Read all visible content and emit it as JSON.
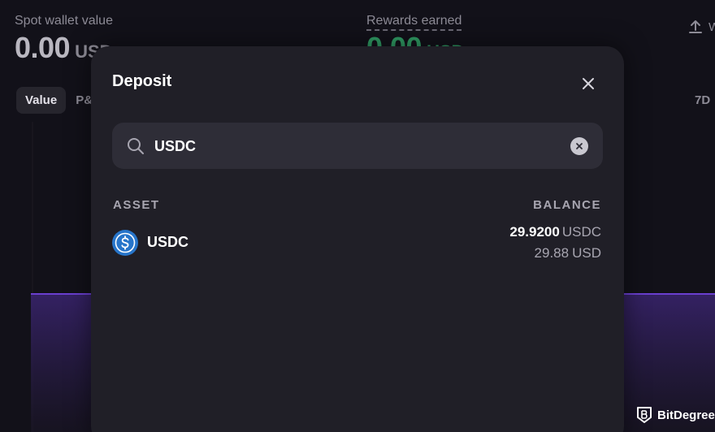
{
  "background": {
    "spot_wallet_label": "Spot wallet value",
    "spot_wallet_value": "0.00",
    "spot_wallet_currency": "USD",
    "rewards_label": "Rewards earned",
    "rewards_value": "0.00",
    "rewards_currency": "USD",
    "withdraw_label": "W",
    "tabs": [
      {
        "label": "Value",
        "active": true
      },
      {
        "label": "P&",
        "active": false
      }
    ],
    "range_label": "7D"
  },
  "modal": {
    "title": "Deposit",
    "search": {
      "value": "USDC",
      "placeholder": ""
    },
    "columns": {
      "asset": "ASSET",
      "balance": "BALANCE"
    },
    "rows": [
      {
        "asset": "USDC",
        "icon": "usdc-coin-icon",
        "balance_amount": "29.9200",
        "balance_unit": "USDC",
        "fiat_amount": "29.88",
        "fiat_unit": "USD"
      }
    ]
  },
  "watermark": {
    "text": "BitDegree"
  },
  "colors": {
    "page_bg": "#121119",
    "modal_bg": "#201f27",
    "search_bg": "#2e2d37",
    "accent_purple": "#6a3fd0",
    "rewards_green": "#2f9a63",
    "usdc_blue": "#2775ca"
  }
}
